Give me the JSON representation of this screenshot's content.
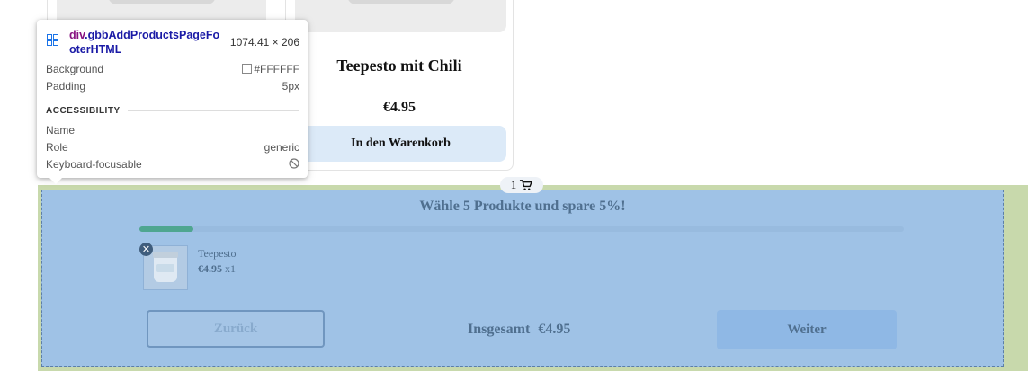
{
  "products": {
    "right_card": {
      "name": "Teepesto mit Chili",
      "price": "€4.95",
      "add_to_cart": "In den Warenkorb"
    }
  },
  "cart_toggle": {
    "count": "1"
  },
  "footer": {
    "title": "Wähle 5 Produkte und spare 5%!",
    "progress": 0.07,
    "item": {
      "name": "Teepesto",
      "price": "€4.95",
      "qty": "x1",
      "remove_icon": "✕"
    },
    "back_label": "Zurück",
    "total_label": "Insgesamt",
    "total_value": "€4.95",
    "next_label": "Weiter"
  },
  "devtools_tooltip": {
    "selector_tag": "div",
    "selector_class": ".gbbAddProductsPageFooterHTML",
    "size": "1074.41 × 206",
    "background_label": "Background",
    "background_value": "#FFFFFF",
    "padding_label": "Padding",
    "padding_value": "5px",
    "section": "ACCESSIBILITY",
    "name_label": "Name",
    "role_label": "Role",
    "role_value": "generic",
    "keyboard_label": "Keyboard-focusable"
  },
  "colors": {
    "overlay_content": "#9fc2e6",
    "overlay_margin": "#c8d9ac",
    "progress_fill": "#4fa690",
    "button_blue": "#dceaf8"
  }
}
